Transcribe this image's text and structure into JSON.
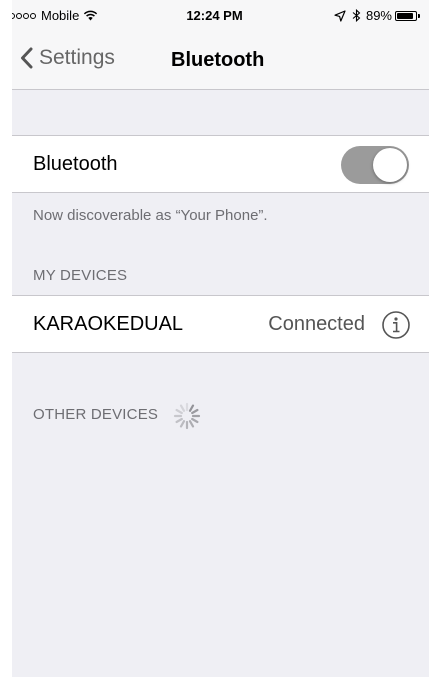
{
  "status_bar": {
    "carrier": "Mobile",
    "time": "12:24 PM",
    "battery_text": "89%",
    "battery_level": 0.89,
    "signal_bars_filled": 1,
    "signal_bars_total": 5,
    "icons": [
      "wifi-icon",
      "location-arrow-icon",
      "bluetooth-icon",
      "battery-icon"
    ]
  },
  "nav": {
    "back_label": "Settings",
    "title": "Bluetooth"
  },
  "bluetooth_row": {
    "label": "Bluetooth",
    "enabled": true
  },
  "discoverable_text": "Now discoverable as “Your Phone”.",
  "my_devices": {
    "header": "MY DEVICES",
    "items": [
      {
        "name": "KARAOKEDUAL",
        "status": "Connected"
      }
    ]
  },
  "other_devices": {
    "header": "OTHER DEVICES"
  },
  "colors": {
    "bar_background": "#f7f7f8",
    "group_background": "#efeff4",
    "separator": "#c8c7cc",
    "toggle_track": "#9b9b9b",
    "secondary_text": "#6d6d72"
  }
}
